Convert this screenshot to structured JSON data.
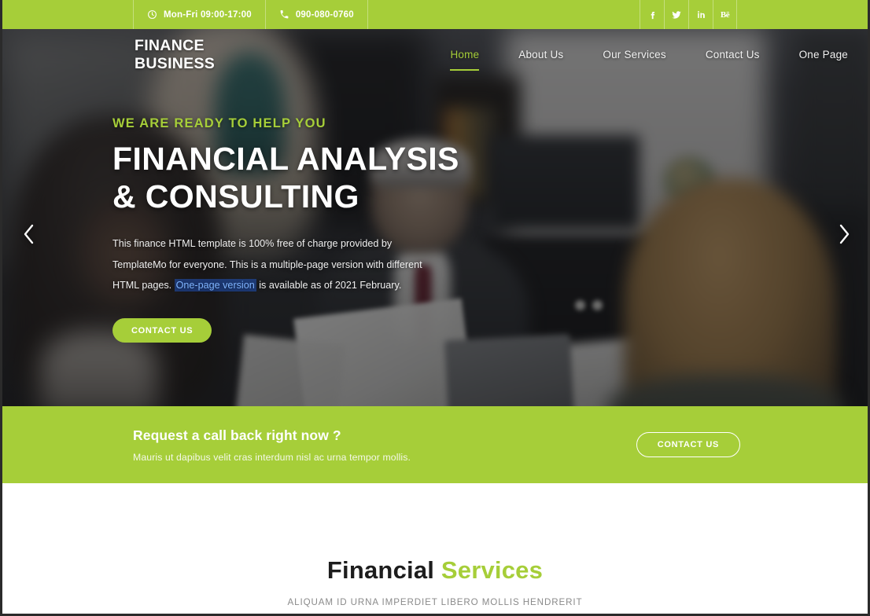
{
  "topbar": {
    "hours": "Mon-Fri 09:00-17:00",
    "phone": "090-080-0760",
    "hours_icon": "clock-icon",
    "phone_icon": "phone-icon",
    "socials": [
      {
        "name": "facebook",
        "label": "f"
      },
      {
        "name": "twitter",
        "label": ""
      },
      {
        "name": "linkedin",
        "label": "in"
      },
      {
        "name": "behance",
        "label": "Bē"
      }
    ]
  },
  "header": {
    "logo": "FINANCE BUSINESS",
    "nav": [
      {
        "label": "Home",
        "active": true
      },
      {
        "label": "About Us",
        "active": false
      },
      {
        "label": "Our Services",
        "active": false
      },
      {
        "label": "Contact Us",
        "active": false
      },
      {
        "label": "One Page",
        "active": false
      }
    ]
  },
  "hero": {
    "kicker": "WE ARE READY TO HELP YOU",
    "title_line1": "FINANCIAL ANALYSIS",
    "title_line2": "& CONSULTING",
    "desc_part1": "This finance HTML template is 100% free of charge provided by TemplateMo for everyone. This is a multiple-page version with different HTML pages. ",
    "desc_link": "One-page version",
    "desc_part2": " is available as of 2021 February.",
    "button": "CONTACT US",
    "prev_arrow_icon": "chevron-left-icon",
    "next_arrow_icon": "chevron-right-icon"
  },
  "callback": {
    "title": "Request a call back right now ?",
    "subtitle": "Mauris ut dapibus velit cras interdum nisl ac urna tempor mollis.",
    "button": "CONTACT US"
  },
  "services": {
    "title_dark": "Financial",
    "title_accent": "Services",
    "subtitle": "ALIQUAM ID URNA IMPERDIET LIBERO MOLLIS HENDRERIT"
  },
  "colors": {
    "brand_green": "#a6ce39",
    "dark_text": "#1d1d1d",
    "muted_text": "#8a8a8a",
    "link_blue": "#7fb4ff"
  }
}
